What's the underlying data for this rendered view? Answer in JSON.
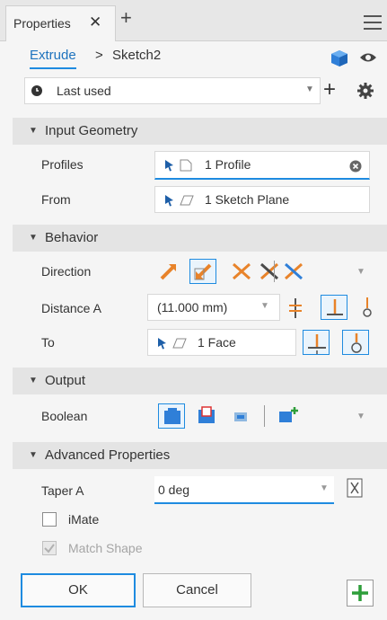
{
  "tab": {
    "label": "Properties",
    "close": "✕",
    "add": "+"
  },
  "breadcrumb": {
    "feature": "Extrude",
    "separator": ">",
    "sketch": "Sketch2"
  },
  "preset": {
    "value": "Last used",
    "add": "+"
  },
  "sections": {
    "input_geometry": "Input Geometry",
    "behavior": "Behavior",
    "output": "Output",
    "advanced": "Advanced Properties"
  },
  "input_geometry": {
    "profiles_label": "Profiles",
    "profiles_value": "1 Profile",
    "from_label": "From",
    "from_value": "1 Sketch Plane"
  },
  "behavior": {
    "direction_label": "Direction",
    "distance_label": "Distance A",
    "distance_value": "(11.000 mm)",
    "to_label": "To",
    "to_value": "1 Face"
  },
  "output": {
    "boolean_label": "Boolean"
  },
  "advanced": {
    "taper_label": "Taper A",
    "taper_value": "0 deg",
    "imate_label": "iMate",
    "match_shape_label": "Match Shape"
  },
  "buttons": {
    "ok": "OK",
    "cancel": "Cancel"
  },
  "colors": {
    "accent": "#1e8be0",
    "link": "#1e73be",
    "apply_green": "#2e9e3a",
    "icon_orange": "#e8832a"
  }
}
